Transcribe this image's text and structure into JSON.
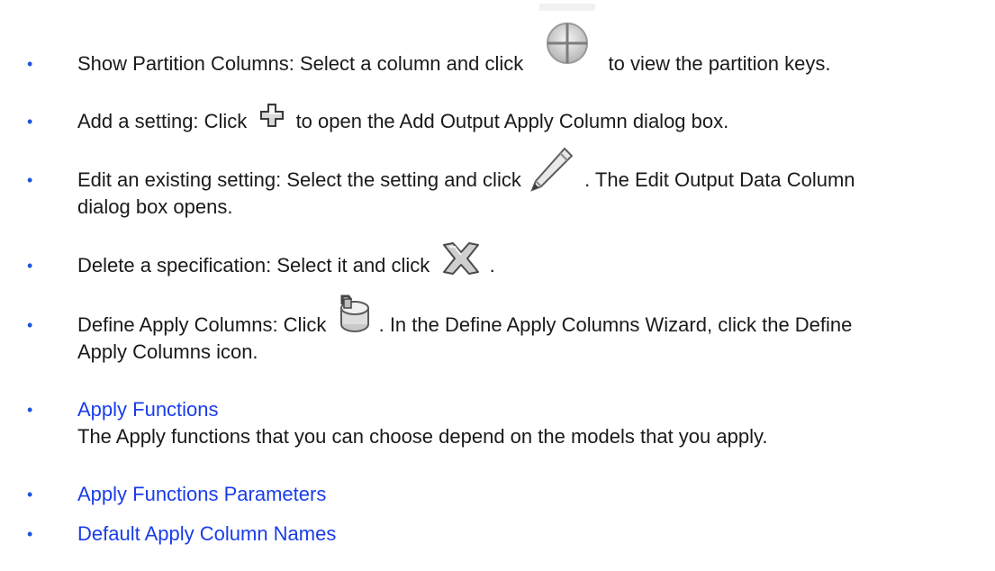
{
  "items": [
    {
      "before": "Show Partition Columns: Select a column and click",
      "after": "to view the partition keys.",
      "icon": "partition-columns-icon"
    },
    {
      "before": "Add a setting: Click",
      "after": "to open the Add Output Apply Column dialog box.",
      "icon": "add-icon"
    },
    {
      "before": "Edit an existing setting: Select the setting and click",
      "after": ". The Edit Output Data Column",
      "line2": "dialog box opens.",
      "icon": "pencil-edit-icon"
    },
    {
      "before": "Delete a specification: Select it and click",
      "after": ".",
      "icon": "delete-x-icon"
    },
    {
      "before": "Define Apply Columns: Click",
      "after": ". In the Define Apply Columns Wizard, click the Define",
      "line2": "Apply Columns icon.",
      "icon": "define-apply-columns-icon"
    },
    {
      "link": "Apply Functions",
      "line2": "The Apply functions that you can choose depend on the models that you apply."
    },
    {
      "link": "Apply Functions Parameters"
    },
    {
      "link": "Default Apply Column Names"
    }
  ],
  "colors": {
    "bullet": "#1a56db",
    "link": "#1a3de8",
    "text": "#1a1a1a"
  }
}
